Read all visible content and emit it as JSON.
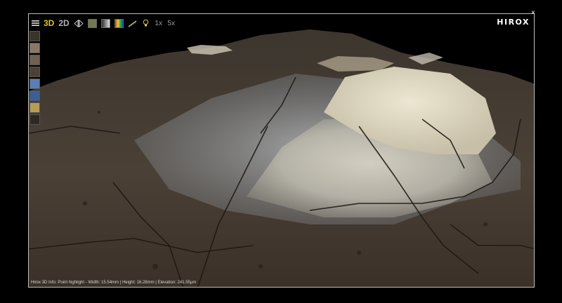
{
  "toolbar": {
    "menu_icon": "hamburger-menu-icon",
    "mode_3d": "3D",
    "mode_2d": "2D",
    "zoom_1": "1x",
    "zoom_5": "5x",
    "active_color": "#e4c12a"
  },
  "brand": {
    "logo": "HIROX"
  },
  "window": {
    "close_glyph": "×"
  },
  "sidebar": {
    "thumbnails": [
      {
        "name": "view-thumb-1"
      },
      {
        "name": "view-thumb-2"
      },
      {
        "name": "view-thumb-3"
      },
      {
        "name": "view-thumb-4"
      },
      {
        "name": "view-thumb-5"
      },
      {
        "name": "view-thumb-6"
      },
      {
        "name": "view-thumb-7"
      },
      {
        "name": "view-thumb-8"
      }
    ]
  },
  "status": {
    "text": "Hirox 3D Info: Point highlight - Width: 15.54mm | Height: 16.28mm | Elevation: 241.55µm"
  }
}
